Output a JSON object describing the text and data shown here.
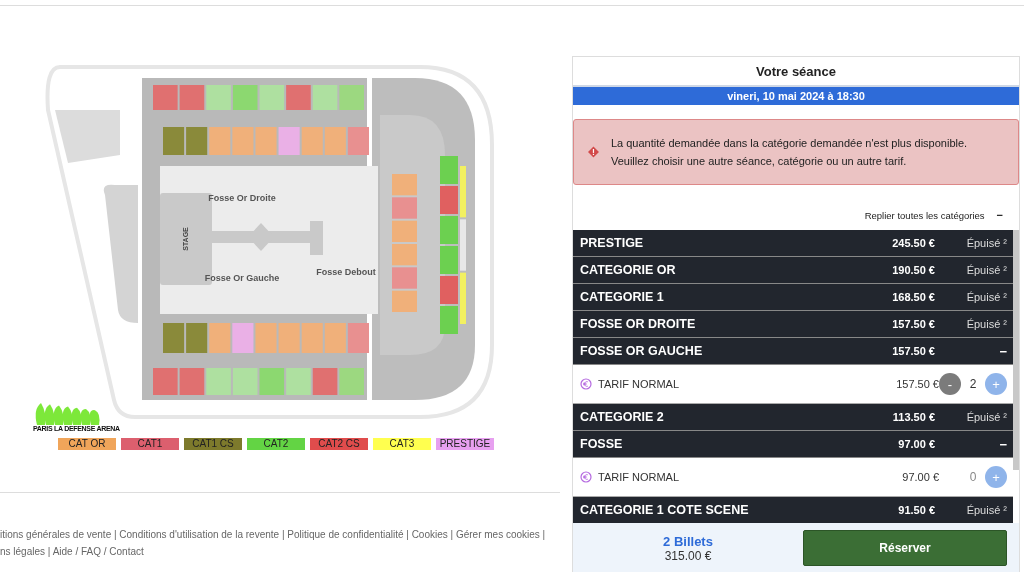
{
  "seat_map": {
    "labels": [
      "STAGE",
      "Fosse Or Droite",
      "Fosse Or Gauche",
      "Fosse Debout"
    ],
    "logo": "PARIS LA DEFENSE ARENA",
    "legend": [
      {
        "label": "CAT OR",
        "color": "#f0a55a"
      },
      {
        "label": "CAT1",
        "color": "#dc5f6e"
      },
      {
        "label": "CAT1 CS",
        "color": "#7d7a2c"
      },
      {
        "label": "CAT2",
        "color": "#63d444"
      },
      {
        "label": "CAT2 CS",
        "color": "#e04c4c"
      },
      {
        "label": "CAT3",
        "color": "#ffff4f"
      },
      {
        "label": "PRESTIGE",
        "color": "#e7a0f0"
      }
    ]
  },
  "footer": {
    "lines": [
      "itions générales de vente | Conditions d'utilisation de la revente | Politique de confidentialité | Cookies | Gérer mes cookies |",
      "ns légales | Aide / FAQ / Contact"
    ]
  },
  "panel": {
    "title": "Votre séance",
    "date": "vineri, 10 mai 2024 à 18:30",
    "alert": "La quantité demandée dans la catégorie demandée n'est plus disponible. Veuillez choisir une autre séance, catégorie ou un autre tarif.",
    "collapse_all": "Replier toutes les catégories",
    "collapse_icon": "−",
    "categories": [
      {
        "name": "PRESTIGE",
        "price": "245.50 €",
        "status": "Épuisé ²",
        "expanded": false
      },
      {
        "name": "CATEGORIE OR",
        "price": "190.50 €",
        "status": "Épuisé ²",
        "expanded": false
      },
      {
        "name": "CATEGORIE 1",
        "price": "168.50 €",
        "status": "Épuisé ²",
        "expanded": false
      },
      {
        "name": "FOSSE OR DROITE",
        "price": "157.50 €",
        "status": "Épuisé ²",
        "expanded": false
      },
      {
        "name": "FOSSE OR GAUCHE",
        "price": "157.50 €",
        "status": "−",
        "expanded": true,
        "tariffs": [
          {
            "label": "TARIF NORMAL",
            "price": "157.50 €",
            "quantity": "2",
            "minus": "-",
            "plus": "+",
            "can_decrease": true
          }
        ]
      },
      {
        "name": "CATEGORIE 2",
        "price": "113.50 €",
        "status": "Épuisé ²",
        "expanded": false
      },
      {
        "name": "FOSSE",
        "price": "97.00 €",
        "status": "−",
        "expanded": true,
        "tariffs": [
          {
            "label": "TARIF NORMAL",
            "price": "97.00 €",
            "quantity": "0",
            "plus": "+",
            "can_decrease": false
          }
        ]
      },
      {
        "name": "CATEGORIE 1 COTE SCENE",
        "price": "91.50 €",
        "status": "Épuisé ²",
        "expanded": false
      }
    ],
    "summary": {
      "tickets": "2 Billets",
      "total": "315.00 €",
      "button": "Réserver"
    }
  }
}
